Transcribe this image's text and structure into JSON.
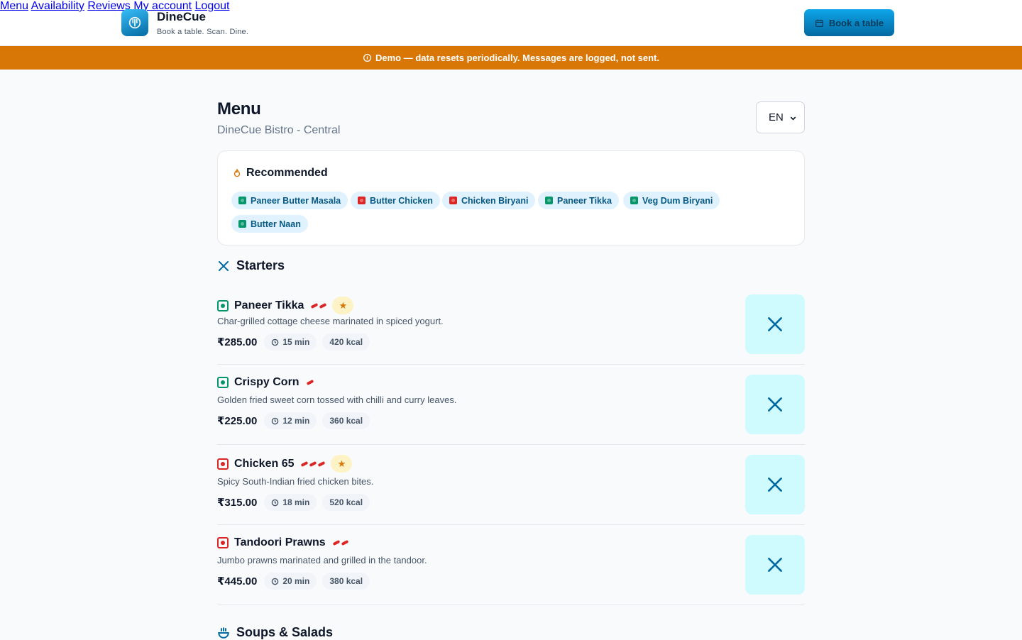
{
  "brand": {
    "name": "DineCue",
    "tagline": "Book a table. Scan. Dine."
  },
  "nav": {
    "items": [
      "Menu",
      "Availability",
      "Reviews",
      "My account",
      "Logout"
    ],
    "book_label": "Book a table"
  },
  "banner": {
    "text": "Demo — data resets periodically. Messages are logged, not sent."
  },
  "page": {
    "title": "Menu",
    "subtitle": "DineCue Bistro - Central",
    "language": "EN"
  },
  "recommended": {
    "title": "Recommended",
    "items": [
      {
        "label": "Paneer Butter Masala",
        "diet": "veg"
      },
      {
        "label": "Butter Chicken",
        "diet": "nonveg"
      },
      {
        "label": "Chicken Biryani",
        "diet": "nonveg"
      },
      {
        "label": "Paneer Tikka",
        "diet": "veg"
      },
      {
        "label": "Veg Dum Biryani",
        "diet": "veg"
      },
      {
        "label": "Butter Naan",
        "diet": "veg"
      }
    ]
  },
  "sections": [
    {
      "title": "Starters",
      "icon": "utensils-icon",
      "items": [
        {
          "name": "Paneer Tikka",
          "diet": "veg",
          "spice": 2,
          "featured": true,
          "desc": "Char-grilled cottage cheese marinated in spiced yogurt.",
          "price": "₹285.00",
          "time": "15 min",
          "kcal": "420 kcal"
        },
        {
          "name": "Crispy Corn",
          "diet": "veg",
          "spice": 1,
          "featured": false,
          "desc": "Golden fried sweet corn tossed with chilli and curry leaves.",
          "price": "₹225.00",
          "time": "12 min",
          "kcal": "360 kcal"
        },
        {
          "name": "Chicken 65",
          "diet": "nonveg",
          "spice": 3,
          "featured": true,
          "desc": "Spicy South-Indian fried chicken bites.",
          "price": "₹315.00",
          "time": "18 min",
          "kcal": "520 kcal"
        },
        {
          "name": "Tandoori Prawns",
          "diet": "nonveg",
          "spice": 2,
          "featured": false,
          "desc": "Jumbo prawns marinated and grilled in the tandoor.",
          "price": "₹445.00",
          "time": "20 min",
          "kcal": "380 kcal"
        }
      ]
    },
    {
      "title": "Soups & Salads",
      "icon": "bowl-icon",
      "items": []
    }
  ],
  "colors": {
    "accent": "#0284c7",
    "banner": "#d97706",
    "veg": "#059669",
    "nonveg": "#dc2626"
  }
}
